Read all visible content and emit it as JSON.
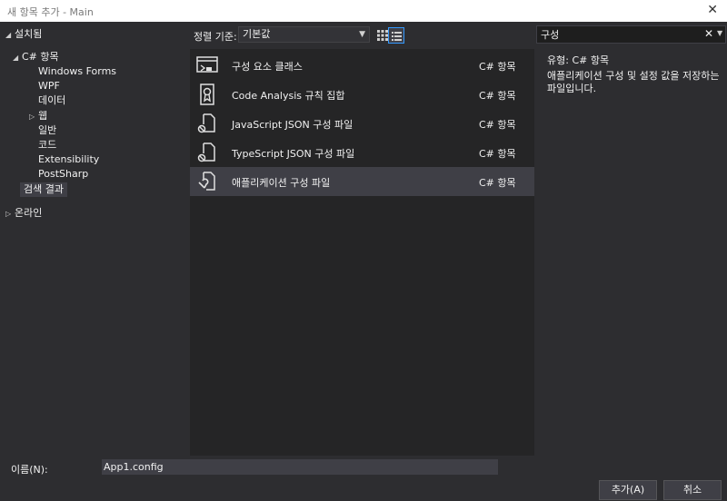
{
  "window": {
    "title": "새 항목 추가 - Main",
    "close_glyph": "✕"
  },
  "tree": {
    "installed": "설치됨",
    "csharp_items": "C# 항목",
    "children": [
      "Windows Forms",
      "WPF",
      "데이터",
      "웹",
      "일반",
      "코드",
      "Extensibility",
      "PostSharp"
    ],
    "search_results": "검색 결과",
    "online": "온라인"
  },
  "toolbar": {
    "sort_label": "정렬 기준:",
    "sort_value": "기본값"
  },
  "templates": [
    {
      "name": "구성 요소 클래스",
      "type": "C# 항목",
      "icon": "component-class-icon"
    },
    {
      "name": "Code Analysis 규칙 집합",
      "type": "C# 항목",
      "icon": "ruleset-icon"
    },
    {
      "name": "JavaScript JSON 구성 파일",
      "type": "C# 항목",
      "icon": "json-config-icon"
    },
    {
      "name": "TypeScript JSON 구성 파일",
      "type": "C# 항목",
      "icon": "json-config-icon"
    },
    {
      "name": "애플리케이션 구성 파일",
      "type": "C# 항목",
      "icon": "app-config-icon",
      "selected": true
    }
  ],
  "search": {
    "value": "구성"
  },
  "details": {
    "type_line": "유형:  C# 항목",
    "description": "애플리케이션 구성 및 설정 값을 저장하는 파일입니다."
  },
  "footer": {
    "name_label": "이름(N):",
    "name_value": "App1.config",
    "add_button": "추가(A)",
    "cancel_button": "취소"
  },
  "colors": {
    "accent": "#3399ff",
    "background": "#2d2d30",
    "list_bg": "#252526",
    "selection": "#3f3f46"
  }
}
